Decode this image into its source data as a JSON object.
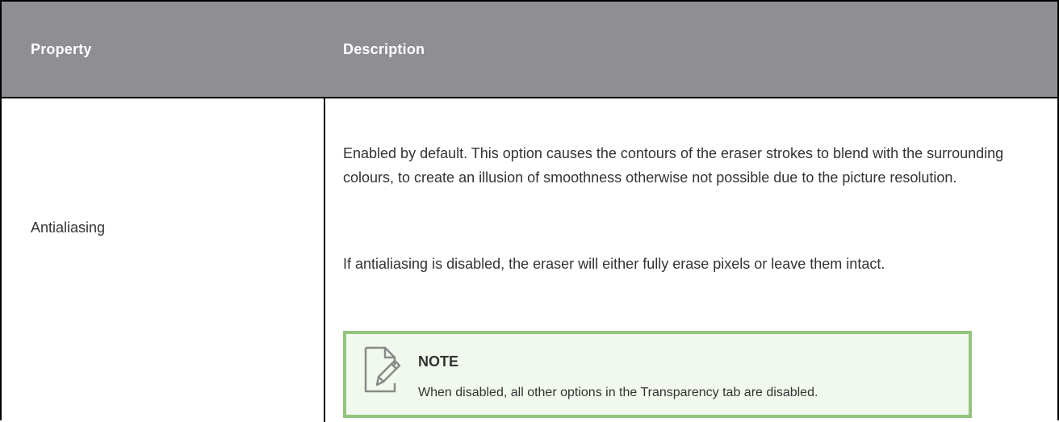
{
  "table": {
    "headers": {
      "property": "Property",
      "description": "Description"
    },
    "rows": [
      {
        "property": "Antialiasing",
        "description": {
          "paragraph1": "Enabled by default. This option causes the contours of the eraser strokes to blend with the surrounding colours, to create an illusion of smoothness otherwise not possible due to the picture resolution.",
          "paragraph2": "If antialiasing is disabled, the eraser will either fully erase pixels or leave them intact.",
          "note": {
            "icon": "note-edit-icon",
            "title": "NOTE",
            "text": "When disabled, all other options in the Transparency tab are disabled."
          }
        }
      }
    ]
  },
  "colors": {
    "header_background": "#8e8e93",
    "header_text": "#ffffff",
    "note_border": "#93c47d",
    "note_background": "#f1f8ee",
    "body_text": "#333333"
  }
}
